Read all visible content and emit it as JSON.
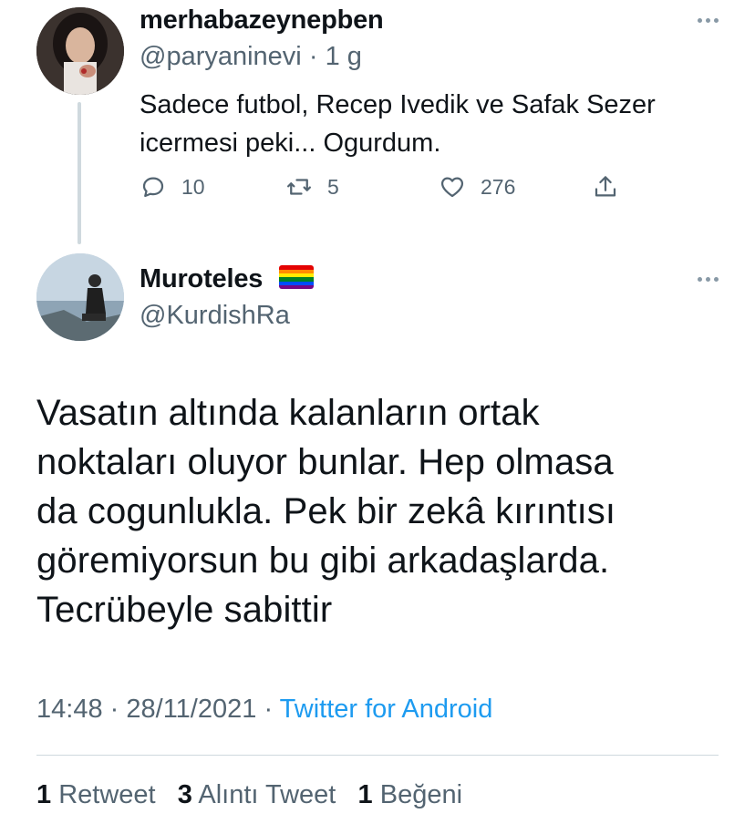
{
  "reply_tweet": {
    "display_name": "merhabazeynepben",
    "handle": "@paryaninevi",
    "separator": "·",
    "time_ago": "1 g",
    "text_line1": "Sadece futbol, Recep Ivedik ve Safak Sezer",
    "text_line2": "icermesi peki... Ogurdum.",
    "replies": "10",
    "retweets": "5",
    "likes": "276"
  },
  "main_tweet": {
    "display_name": "Muroteles",
    "handle": "@KurdishRa",
    "text_lines": [
      "Vasatın altında kalanların ortak",
      "noktaları oluyor bunlar. Hep olmasa",
      "da cogunlukla. Pek bir zekâ kırıntısı",
      "göremiyorsun bu gibi arkadaşlarda.",
      "Tecrübeyle sabittir"
    ],
    "time": "14:48",
    "date": "28/11/2021",
    "source": "Twitter for Android",
    "stats": {
      "retweets_count": "1",
      "retweets_label": "Retweet",
      "quotes_count": "3",
      "quotes_label": "Alıntı Tweet",
      "likes_count": "1",
      "likes_label": "Beğeni"
    }
  },
  "icons": {
    "more": "more-dots-icon",
    "reply": "reply-bubble-icon",
    "retweet": "retweet-arrows-icon",
    "like": "heart-icon",
    "share": "share-upload-icon",
    "name_emoji": "rainbow-flag-icon"
  },
  "colors": {
    "text": "#0f1419",
    "secondary": "#536471",
    "link": "#1d9bf0",
    "divider": "#cfd9de"
  }
}
